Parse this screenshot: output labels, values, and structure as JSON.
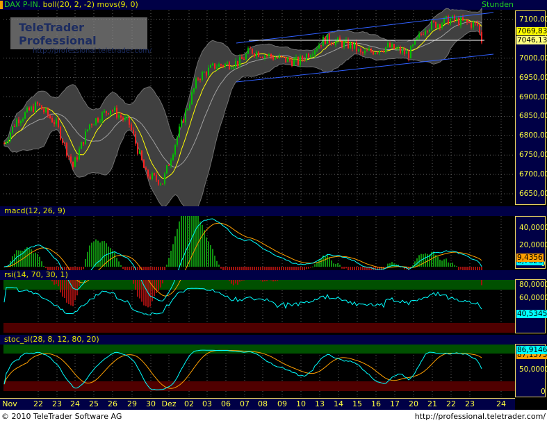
{
  "header": {
    "symbol": "DAX P-IN.",
    "indicators": "boll(20, 2, -2) movs(9, 0)",
    "timeframe": "Stunden"
  },
  "watermark": {
    "title": "TeleTrader Professional",
    "url": "http://professional.teletrader.com/"
  },
  "price_axis": {
    "ticks": [
      "7100,00",
      "7000,00",
      "6950,00",
      "6900,00",
      "6850,00",
      "6800,00",
      "6750,00",
      "6700,00",
      "6650,00"
    ],
    "tick_values": [
      7100,
      7000,
      6950,
      6900,
      6850,
      6800,
      6750,
      6700,
      6650
    ],
    "last": "7069,83",
    "level": "7046,13"
  },
  "macd": {
    "title": "macd(12, 26, 9)",
    "ticks": [
      "40,0000",
      "20,0000",
      "0"
    ],
    "value": "9,4356",
    "signal": "8,7823"
  },
  "rsi": {
    "title": "rsi(14, 70, 30, 1)",
    "ticks": [
      "80,0000",
      "60,0000"
    ],
    "value": "40,5345"
  },
  "stoc": {
    "title": "stoc_sl(28, 8, 12, 80, 20)",
    "ticks": [
      "50,0000",
      "0"
    ],
    "value": "86,9146",
    "signal": "87,1575"
  },
  "dates": [
    "Nov",
    "22",
    "23",
    "24",
    "25",
    "26",
    "29",
    "30",
    "Dez",
    "02",
    "03",
    "06",
    "07",
    "08",
    "09",
    "10",
    "13",
    "14",
    "15",
    "16",
    "17",
    "20",
    "21",
    "22",
    "23",
    "24"
  ],
  "footer": {
    "copyright": "© 2010 TeleTrader Software AG",
    "url": "http://professional.teletrader.com/"
  },
  "colors": {
    "up": "#00c000",
    "down": "#ff2020",
    "boll": "#a0a0a0",
    "movs": "#ffff00",
    "channel": "#3060ff",
    "macd": "#00ffff",
    "signal": "#ffa000"
  },
  "chart_data": {
    "type": "candlestick",
    "ylim": [
      6630,
      7120
    ],
    "price_keypoints": [
      [
        0,
        6780
      ],
      [
        6,
        6840
      ],
      [
        16,
        6880
      ],
      [
        25,
        6830
      ],
      [
        33,
        6720
      ],
      [
        41,
        6830
      ],
      [
        51,
        6870
      ],
      [
        60,
        6830
      ],
      [
        68,
        6700
      ],
      [
        76,
        6680
      ],
      [
        85,
        6830
      ],
      [
        93,
        6950
      ],
      [
        101,
        6980
      ],
      [
        113,
        6990
      ],
      [
        118,
        7020
      ],
      [
        131,
        7000
      ],
      [
        141,
        6990
      ],
      [
        154,
        7050
      ],
      [
        168,
        7030
      ],
      [
        171,
        7010
      ],
      [
        184,
        7030
      ],
      [
        194,
        7010
      ],
      [
        202,
        7080
      ],
      [
        214,
        7100
      ],
      [
        227,
        7085
      ],
      [
        229,
        7046
      ]
    ]
  }
}
